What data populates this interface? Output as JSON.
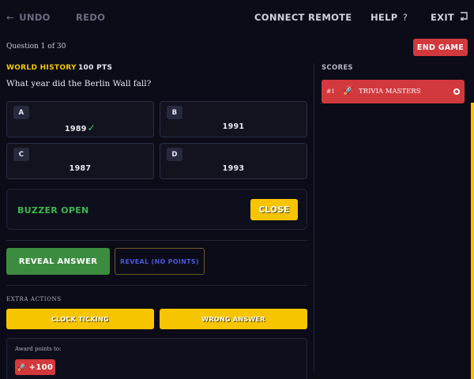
{
  "toolbar": {
    "undo_label": "UNDO",
    "redo_label": "REDO",
    "connect_label": "CONNECT REMOTE",
    "help_label": "HELP",
    "exit_label": "EXIT",
    "undo_icon": "arrow-left-icon",
    "help_icon": "question-mark-icon",
    "exit_icon": "exit-icon"
  },
  "question": {
    "counter": "Question 1 of 30",
    "category": "WORLD HISTORY",
    "points": "100 PTS",
    "text": "What year did the Berlin Wall fall?",
    "answers": [
      {
        "letter": "A",
        "value": "1989",
        "correct": true
      },
      {
        "letter": "B",
        "value": "1991",
        "correct": false
      },
      {
        "letter": "C",
        "value": "1987",
        "correct": false
      },
      {
        "letter": "D",
        "value": "1993",
        "correct": false
      }
    ],
    "correct_mark": "✓"
  },
  "end_game_label": "END GAME",
  "buzzer": {
    "status": "BUZZER OPEN",
    "close_label": "CLOSE"
  },
  "reveal": {
    "answer_label": "REVEAL ANSWER",
    "no_points_label": "REVEAL (NO POINTS)"
  },
  "extra_actions": {
    "label": "EXTRA ACTIONS",
    "clock_label": "CLOCK TICKING",
    "wrong_label": "WRONG ANSWER"
  },
  "award": {
    "label": "Award points to:",
    "button_emoji": "🚀",
    "button_value": "+100"
  },
  "scores": {
    "label": "SCORES",
    "teams": [
      {
        "rank": "#1",
        "emoji": "🚀",
        "name": "TRIVIA MASTERS"
      }
    ]
  },
  "colors": {
    "accent_yellow": "#f6c500",
    "accent_red": "#d2393d",
    "accent_green": "#3c8c40",
    "background": "#0b0c18"
  }
}
